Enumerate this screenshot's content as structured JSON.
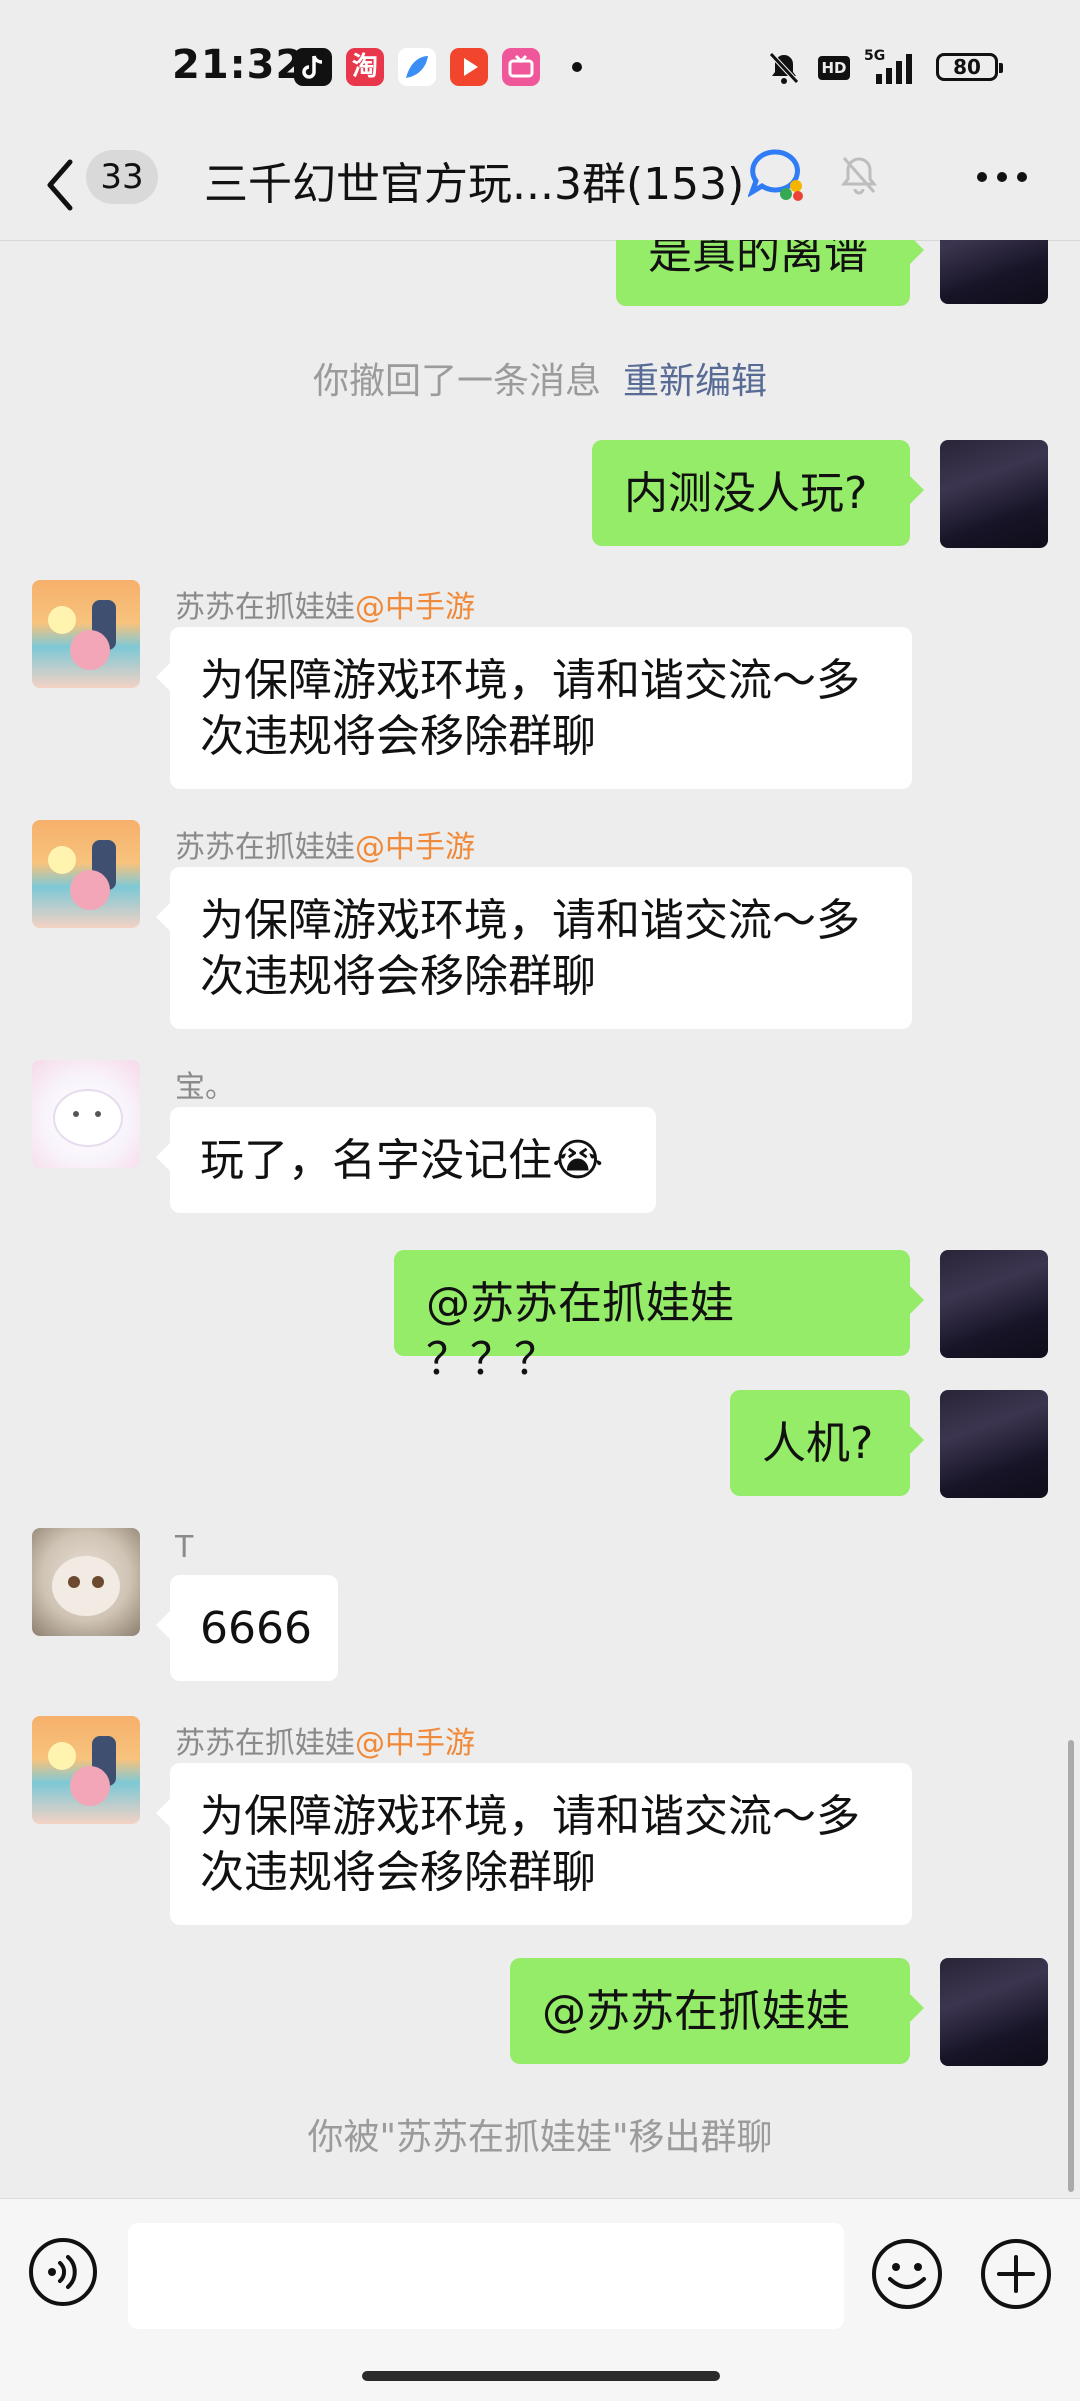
{
  "status_bar": {
    "time": "21:32",
    "battery": "80",
    "network": "5G"
  },
  "nav": {
    "unread_count": "33",
    "title": "三千幻世官方玩...3群(153)"
  },
  "messages": {
    "m0": {
      "text": "是真的离谱"
    },
    "sys1": {
      "text": "你撤回了一条消息",
      "link": "重新编辑"
    },
    "m1": {
      "text": "内测没人玩?"
    },
    "m2": {
      "sender": "苏苏在抓娃娃",
      "sender_tag": "@中手游",
      "text": "为保障游戏环境，请和谐交流～多次违规将会移除群聊"
    },
    "m3": {
      "sender": "苏苏在抓娃娃",
      "sender_tag": "@中手游",
      "text": "为保障游戏环境，请和谐交流～多次违规将会移除群聊"
    },
    "m4": {
      "sender": "宝。",
      "text": "玩了，名字没记住😭"
    },
    "m5": {
      "text": "@苏苏在抓娃娃 ？？？"
    },
    "m6": {
      "text": "人机?"
    },
    "m7": {
      "sender": "T",
      "text": "6666"
    },
    "m8": {
      "sender": "苏苏在抓娃娃",
      "sender_tag": "@中手游",
      "text": "为保障游戏环境，请和谐交流～多次违规将会移除群聊"
    },
    "m9": {
      "text": "@苏苏在抓娃娃"
    },
    "sys2": {
      "text": "你被\"苏苏在抓娃娃\"移出群聊"
    }
  },
  "colors": {
    "accent_green": "#95ec69",
    "tag_orange": "#f08a3a",
    "link_blue": "#576b95"
  },
  "icons": [
    "chevron-left-icon",
    "group-chat-icon",
    "mute-bell-icon",
    "more-icon",
    "voice-icon",
    "emoji-icon",
    "plus-icon"
  ]
}
